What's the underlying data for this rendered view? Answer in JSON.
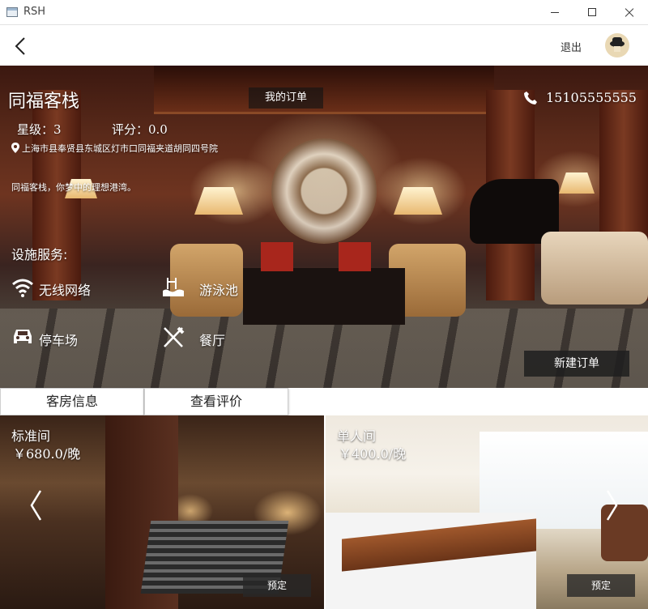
{
  "window": {
    "title": "RSH"
  },
  "appbar": {
    "logout_label": "退出"
  },
  "hotel": {
    "name": "同福客栈",
    "my_orders_label": "我的订单",
    "phone": "15105555555",
    "star_level": "星级：3",
    "rating": "评分：0.0",
    "address": "上海市县奉贤县东城区灯市口同福夹道胡同四号院",
    "slogan": "同福客栈，你梦中的理想港湾。",
    "facilities_label": "设施服务:",
    "facilities": [
      {
        "label": "无线网络",
        "icon": "wifi-icon"
      },
      {
        "label": "游泳池",
        "icon": "pool-icon"
      },
      {
        "label": "停车场",
        "icon": "car-icon"
      },
      {
        "label": "餐厅",
        "icon": "restaurant-icon"
      }
    ],
    "new_order_label": "新建订单"
  },
  "tabs": [
    {
      "label": "客房信息"
    },
    {
      "label": "查看评价"
    }
  ],
  "rooms": [
    {
      "name": "标准间",
      "price": "￥680.0/晚",
      "book_label": "预定"
    },
    {
      "name": "单人间",
      "price": "￥400.0/晚",
      "book_label": "预定"
    }
  ],
  "colors": {
    "overlay_button": "#1e1e1e",
    "text_on_image": "#ffffff"
  }
}
